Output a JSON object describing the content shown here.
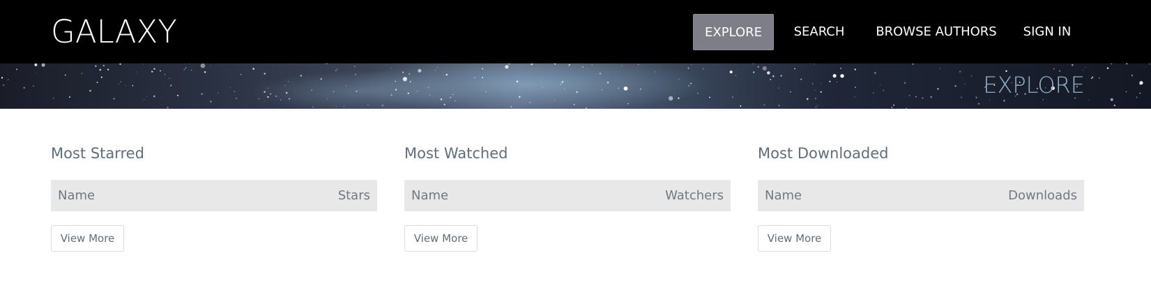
{
  "header": {
    "logo": "GALAXY",
    "nav": [
      "EXPLORE",
      "SEARCH",
      "BROWSE AUTHORS",
      "SIGN IN"
    ],
    "active_nav": "EXPLORE"
  },
  "hero": {
    "title": "EXPLORE"
  },
  "sections": [
    {
      "title": "Most Starred",
      "col_name": "Name",
      "col_metric": "Stars",
      "button": "View More"
    },
    {
      "title": "Most Watched",
      "col_name": "Name",
      "col_metric": "Watchers",
      "button": "View More"
    },
    {
      "title": "Most Downloaded",
      "col_name": "Name",
      "col_metric": "Downloads",
      "button": "View More"
    }
  ],
  "colors": {
    "topbar": "#000000",
    "active_nav_bg": "#7d7e88",
    "hero_title": "#8fb0c8",
    "section_title": "#5f6e7c",
    "table_header_bg": "#e8e8e8"
  }
}
